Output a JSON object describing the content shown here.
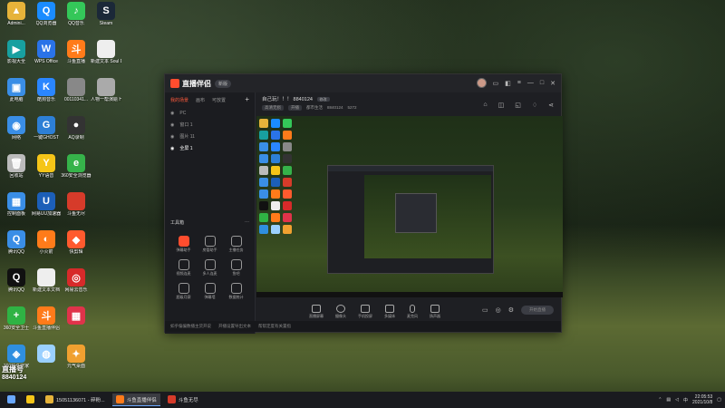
{
  "desktop_icons": [
    {
      "label": "Admini...",
      "color": "#e6b33a",
      "glyph": "▲",
      "col": 0,
      "row": 0
    },
    {
      "label": "QQ浏览器",
      "color": "#1a8cff",
      "glyph": "Q",
      "col": 1,
      "row": 0
    },
    {
      "label": "QQ音乐",
      "color": "#34c759",
      "glyph": "♪",
      "col": 2,
      "row": 0
    },
    {
      "label": "Steam",
      "color": "#1b2838",
      "glyph": "S",
      "col": 3,
      "row": 0
    },
    {
      "label": "影视大全",
      "color": "#18a0a0",
      "glyph": "▶",
      "col": 0,
      "row": 1
    },
    {
      "label": "WPS Office",
      "color": "#2a73e8",
      "glyph": "W",
      "col": 1,
      "row": 1
    },
    {
      "label": "斗鱼直播",
      "color": "#ff7b1a",
      "glyph": "斗",
      "col": 2,
      "row": 1
    },
    {
      "label": "新建文本 Soul D...",
      "color": "#eeeeee",
      "glyph": "",
      "col": 3,
      "row": 1
    },
    {
      "label": "此电脑",
      "color": "#3a8ee6",
      "glyph": "▣",
      "col": 0,
      "row": 2
    },
    {
      "label": "酷狗音乐",
      "color": "#2a86ff",
      "glyph": "K",
      "col": 1,
      "row": 2
    },
    {
      "label": "00110341...",
      "color": "#888888",
      "glyph": "",
      "col": 2,
      "row": 2
    },
    {
      "label": "人物一帮演絵 Human Fa...",
      "color": "#aaaaaa",
      "glyph": "",
      "col": 3,
      "row": 2
    },
    {
      "label": "网络",
      "color": "#3a8ee6",
      "glyph": "◉",
      "col": 0,
      "row": 3
    },
    {
      "label": "一键GHOST",
      "color": "#2d7fd6",
      "glyph": "G",
      "col": 1,
      "row": 3
    },
    {
      "label": "AQ录制",
      "color": "#333333",
      "glyph": "●",
      "col": 2,
      "row": 3
    },
    {
      "label": "回收站",
      "color": "#bbbbbb",
      "glyph": "🗑",
      "col": 0,
      "row": 4
    },
    {
      "label": "YY语音",
      "color": "#f5c518",
      "glyph": "Y",
      "col": 1,
      "row": 4
    },
    {
      "label": "360安全浏览器",
      "color": "#36b34a",
      "glyph": "e",
      "col": 2,
      "row": 4
    },
    {
      "label": "控制面板",
      "color": "#3a8ee6",
      "glyph": "▦",
      "col": 0,
      "row": 5
    },
    {
      "label": "网易UU加速器",
      "color": "#1c5fb8",
      "glyph": "U",
      "col": 1,
      "row": 5
    },
    {
      "label": "斗鱼无尽",
      "color": "#d63b2a",
      "glyph": "",
      "col": 2,
      "row": 5
    },
    {
      "label": "腾讯QQ",
      "color": "#3a8ee6",
      "glyph": "Q",
      "col": 0,
      "row": 6
    },
    {
      "label": "小火箭",
      "color": "#ff7b1a",
      "glyph": "◐",
      "col": 1,
      "row": 6
    },
    {
      "label": "快剪辑",
      "color": "#ff5a2e",
      "glyph": "◆",
      "col": 2,
      "row": 6
    },
    {
      "label": "腾讯QQ",
      "color": "#111111",
      "glyph": "Q",
      "col": 0,
      "row": 7
    },
    {
      "label": "新建文本文档",
      "color": "#eeeeee",
      "glyph": "",
      "col": 1,
      "row": 7
    },
    {
      "label": "网易云音乐",
      "color": "#d72a2a",
      "glyph": "◎",
      "col": 2,
      "row": 7
    },
    {
      "label": "360安全卫士",
      "color": "#2fb344",
      "glyph": "+",
      "col": 0,
      "row": 8
    },
    {
      "label": "斗鱼直播伴侣",
      "color": "#ff7b1a",
      "glyph": "斗",
      "col": 1,
      "row": 8
    },
    {
      "label": "",
      "color": "#e0334a",
      "glyph": "▦",
      "col": 2,
      "row": 8
    },
    {
      "label": "360软件管家",
      "color": "#2f8fe0",
      "glyph": "◈",
      "col": 0,
      "row": 9
    },
    {
      "label": "",
      "color": "#9ad0ff",
      "glyph": "◍",
      "col": 1,
      "row": 9
    },
    {
      "label": "元气桌面",
      "color": "#f0a030",
      "glyph": "✦",
      "col": 2,
      "row": 9
    }
  ],
  "watermark": {
    "line1": "直播号",
    "line2": "8840124"
  },
  "app": {
    "brand": "直播伴侣",
    "version": "新版",
    "left_tabs": [
      "我的场景",
      "画布",
      "可放置"
    ],
    "scenes": [
      {
        "label": "PC",
        "selected": false
      },
      {
        "label": "窗口 1",
        "selected": false
      },
      {
        "label": "图片 11",
        "selected": false
      },
      {
        "label": "全屏 1",
        "selected": true
      }
    ],
    "tools_title": "工具箱",
    "tools": [
      {
        "label": "弹幕助手",
        "red": true
      },
      {
        "label": "房管助手",
        "red": false
      },
      {
        "label": "主播任务",
        "red": false
      },
      {
        "label": "视频连麦",
        "red": false
      },
      {
        "label": "多人连麦",
        "red": false
      },
      {
        "label": "鱼吧",
        "red": false
      },
      {
        "label": "超级月赛",
        "red": false
      },
      {
        "label": "弹幕墙",
        "red": false
      },
      {
        "label": "数据统计",
        "red": false
      }
    ],
    "notices": [
      "如乎偏偏数播主货开说",
      "开播设置导出文本",
      "帮帮定度有关置指"
    ],
    "room": {
      "title": "自己玩！！！",
      "id": "8840124",
      "tag": "修改",
      "sub": [
        "高清无损",
        "开播",
        "都市生活",
        "8840124",
        "5272"
      ]
    },
    "bottom_buttons": [
      "直播屏幕",
      "摄像头",
      "手机投屏",
      "多媒体",
      "麦克风",
      "扬声器"
    ],
    "start_live": "开始直播"
  },
  "taskbar": {
    "items": [
      {
        "label": "",
        "color": "#f5c518"
      },
      {
        "label": "15051136071 - 碎粉...",
        "color": "#e6b33a",
        "active": false
      },
      {
        "label": "斗鱼直播伴侣",
        "color": "#ff7b1a",
        "active": true
      },
      {
        "label": "斗鱼无尽",
        "color": "#d63b2a",
        "active": false
      }
    ],
    "time": "22:05:53",
    "date": "2021/10/8"
  }
}
